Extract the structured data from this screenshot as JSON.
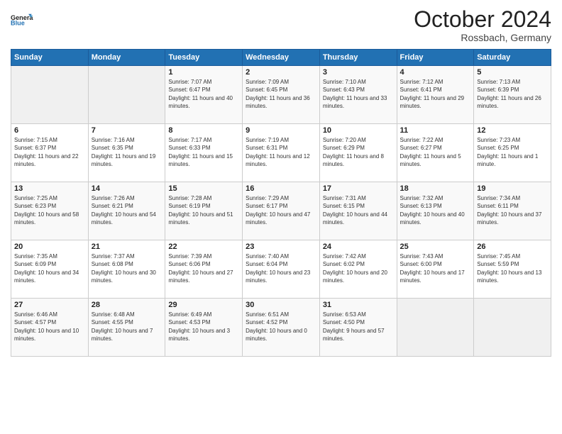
{
  "header": {
    "title": "October 2024",
    "location": "Rossbach, Germany"
  },
  "columns": [
    "Sunday",
    "Monday",
    "Tuesday",
    "Wednesday",
    "Thursday",
    "Friday",
    "Saturday"
  ],
  "weeks": [
    [
      {
        "day": "",
        "sunrise": "",
        "sunset": "",
        "daylight": "",
        "empty": true
      },
      {
        "day": "",
        "sunrise": "",
        "sunset": "",
        "daylight": "",
        "empty": true
      },
      {
        "day": "1",
        "sunrise": "Sunrise: 7:07 AM",
        "sunset": "Sunset: 6:47 PM",
        "daylight": "Daylight: 11 hours and 40 minutes."
      },
      {
        "day": "2",
        "sunrise": "Sunrise: 7:09 AM",
        "sunset": "Sunset: 6:45 PM",
        "daylight": "Daylight: 11 hours and 36 minutes."
      },
      {
        "day": "3",
        "sunrise": "Sunrise: 7:10 AM",
        "sunset": "Sunset: 6:43 PM",
        "daylight": "Daylight: 11 hours and 33 minutes."
      },
      {
        "day": "4",
        "sunrise": "Sunrise: 7:12 AM",
        "sunset": "Sunset: 6:41 PM",
        "daylight": "Daylight: 11 hours and 29 minutes."
      },
      {
        "day": "5",
        "sunrise": "Sunrise: 7:13 AM",
        "sunset": "Sunset: 6:39 PM",
        "daylight": "Daylight: 11 hours and 26 minutes."
      }
    ],
    [
      {
        "day": "6",
        "sunrise": "Sunrise: 7:15 AM",
        "sunset": "Sunset: 6:37 PM",
        "daylight": "Daylight: 11 hours and 22 minutes."
      },
      {
        "day": "7",
        "sunrise": "Sunrise: 7:16 AM",
        "sunset": "Sunset: 6:35 PM",
        "daylight": "Daylight: 11 hours and 19 minutes."
      },
      {
        "day": "8",
        "sunrise": "Sunrise: 7:17 AM",
        "sunset": "Sunset: 6:33 PM",
        "daylight": "Daylight: 11 hours and 15 minutes."
      },
      {
        "day": "9",
        "sunrise": "Sunrise: 7:19 AM",
        "sunset": "Sunset: 6:31 PM",
        "daylight": "Daylight: 11 hours and 12 minutes."
      },
      {
        "day": "10",
        "sunrise": "Sunrise: 7:20 AM",
        "sunset": "Sunset: 6:29 PM",
        "daylight": "Daylight: 11 hours and 8 minutes."
      },
      {
        "day": "11",
        "sunrise": "Sunrise: 7:22 AM",
        "sunset": "Sunset: 6:27 PM",
        "daylight": "Daylight: 11 hours and 5 minutes."
      },
      {
        "day": "12",
        "sunrise": "Sunrise: 7:23 AM",
        "sunset": "Sunset: 6:25 PM",
        "daylight": "Daylight: 11 hours and 1 minute."
      }
    ],
    [
      {
        "day": "13",
        "sunrise": "Sunrise: 7:25 AM",
        "sunset": "Sunset: 6:23 PM",
        "daylight": "Daylight: 10 hours and 58 minutes."
      },
      {
        "day": "14",
        "sunrise": "Sunrise: 7:26 AM",
        "sunset": "Sunset: 6:21 PM",
        "daylight": "Daylight: 10 hours and 54 minutes."
      },
      {
        "day": "15",
        "sunrise": "Sunrise: 7:28 AM",
        "sunset": "Sunset: 6:19 PM",
        "daylight": "Daylight: 10 hours and 51 minutes."
      },
      {
        "day": "16",
        "sunrise": "Sunrise: 7:29 AM",
        "sunset": "Sunset: 6:17 PM",
        "daylight": "Daylight: 10 hours and 47 minutes."
      },
      {
        "day": "17",
        "sunrise": "Sunrise: 7:31 AM",
        "sunset": "Sunset: 6:15 PM",
        "daylight": "Daylight: 10 hours and 44 minutes."
      },
      {
        "day": "18",
        "sunrise": "Sunrise: 7:32 AM",
        "sunset": "Sunset: 6:13 PM",
        "daylight": "Daylight: 10 hours and 40 minutes."
      },
      {
        "day": "19",
        "sunrise": "Sunrise: 7:34 AM",
        "sunset": "Sunset: 6:11 PM",
        "daylight": "Daylight: 10 hours and 37 minutes."
      }
    ],
    [
      {
        "day": "20",
        "sunrise": "Sunrise: 7:35 AM",
        "sunset": "Sunset: 6:09 PM",
        "daylight": "Daylight: 10 hours and 34 minutes."
      },
      {
        "day": "21",
        "sunrise": "Sunrise: 7:37 AM",
        "sunset": "Sunset: 6:08 PM",
        "daylight": "Daylight: 10 hours and 30 minutes."
      },
      {
        "day": "22",
        "sunrise": "Sunrise: 7:39 AM",
        "sunset": "Sunset: 6:06 PM",
        "daylight": "Daylight: 10 hours and 27 minutes."
      },
      {
        "day": "23",
        "sunrise": "Sunrise: 7:40 AM",
        "sunset": "Sunset: 6:04 PM",
        "daylight": "Daylight: 10 hours and 23 minutes."
      },
      {
        "day": "24",
        "sunrise": "Sunrise: 7:42 AM",
        "sunset": "Sunset: 6:02 PM",
        "daylight": "Daylight: 10 hours and 20 minutes."
      },
      {
        "day": "25",
        "sunrise": "Sunrise: 7:43 AM",
        "sunset": "Sunset: 6:00 PM",
        "daylight": "Daylight: 10 hours and 17 minutes."
      },
      {
        "day": "26",
        "sunrise": "Sunrise: 7:45 AM",
        "sunset": "Sunset: 5:59 PM",
        "daylight": "Daylight: 10 hours and 13 minutes."
      }
    ],
    [
      {
        "day": "27",
        "sunrise": "Sunrise: 6:46 AM",
        "sunset": "Sunset: 4:57 PM",
        "daylight": "Daylight: 10 hours and 10 minutes."
      },
      {
        "day": "28",
        "sunrise": "Sunrise: 6:48 AM",
        "sunset": "Sunset: 4:55 PM",
        "daylight": "Daylight: 10 hours and 7 minutes."
      },
      {
        "day": "29",
        "sunrise": "Sunrise: 6:49 AM",
        "sunset": "Sunset: 4:53 PM",
        "daylight": "Daylight: 10 hours and 3 minutes."
      },
      {
        "day": "30",
        "sunrise": "Sunrise: 6:51 AM",
        "sunset": "Sunset: 4:52 PM",
        "daylight": "Daylight: 10 hours and 0 minutes."
      },
      {
        "day": "31",
        "sunrise": "Sunrise: 6:53 AM",
        "sunset": "Sunset: 4:50 PM",
        "daylight": "Daylight: 9 hours and 57 minutes."
      },
      {
        "day": "",
        "sunrise": "",
        "sunset": "",
        "daylight": "",
        "empty": true
      },
      {
        "day": "",
        "sunrise": "",
        "sunset": "",
        "daylight": "",
        "empty": true
      }
    ]
  ]
}
